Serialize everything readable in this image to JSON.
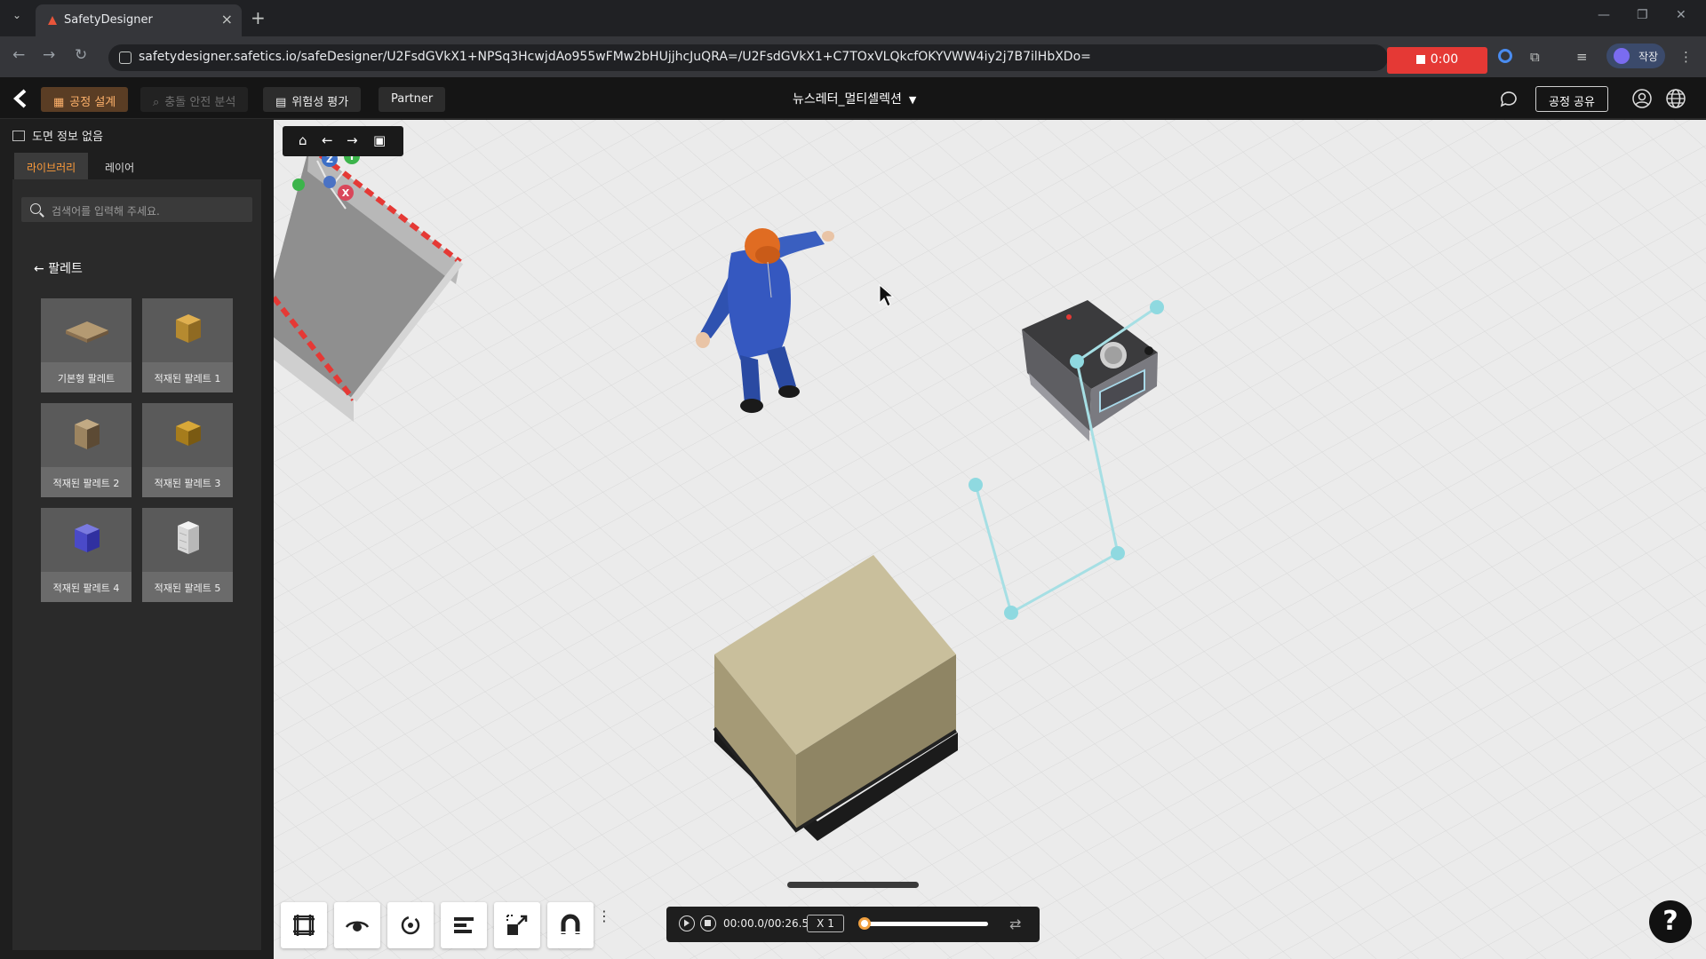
{
  "browser": {
    "tab_title": "SafetyDesigner",
    "url": "safetydesigner.safetics.io/safeDesigner/U2FsdGVkX1+NPSq3HcwjdAo955wFMw2bHUjjhcJuQRA=/U2FsdGVkX1+C7TOxVLQkcfOKYVWW4iy2j7B7ilHbXDo=",
    "recording_time": "0:00",
    "profile_label": "작장"
  },
  "header": {
    "tabs": [
      {
        "label": "공정 설계",
        "state": "active"
      },
      {
        "label": "충돌 안전 분석",
        "state": "disabled"
      },
      {
        "label": "위험성 평가",
        "state": "normal"
      },
      {
        "label": "Partner",
        "state": "normal"
      }
    ],
    "project_name": "뉴스레터_멀티셀렉션",
    "share_label": "공정 공유"
  },
  "sidebar": {
    "plan_info": "도면 정보 없음",
    "tabs": [
      "라이브러리",
      "레이어"
    ],
    "search_placeholder": "검색어를 입력해 주세요.",
    "category": "팔레트",
    "items": [
      {
        "label": "기본형 팔레트"
      },
      {
        "label": "적재된 팔레트 1"
      },
      {
        "label": "적재된 팔레트 2"
      },
      {
        "label": "적재된 팔레트 3"
      },
      {
        "label": "적재된 팔레트 4"
      },
      {
        "label": "적재된 팔레트 5"
      }
    ]
  },
  "viewport": {
    "axes": {
      "x": "X",
      "y": "Y",
      "z": "Z"
    },
    "colors": {
      "accent": "#ff9c3a",
      "path": "#8fd9e0",
      "box": "#c9bf9c"
    }
  },
  "player": {
    "time": "00:00.0/00:26.5",
    "speed": "X 1",
    "progress": 0.0
  },
  "help_label": "?"
}
